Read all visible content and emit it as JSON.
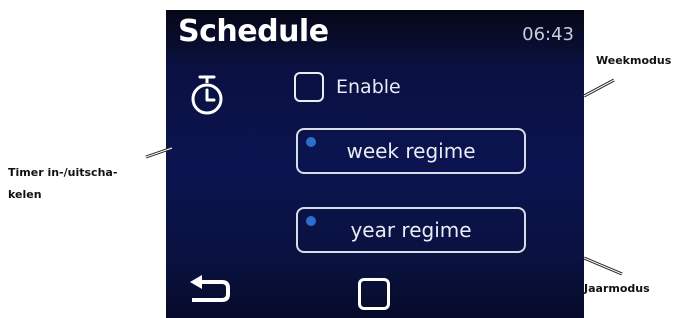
{
  "screen": {
    "title": "Schedule",
    "clock": "06:43",
    "enable_label": "Enable",
    "week_button_label": "week regime",
    "year_button_label": "year regime",
    "enable_checked": false
  },
  "annotations": {
    "timer": "Timer in-/uitscha-kelen",
    "week": "Weekmodus",
    "jaar": "Jaarmodus"
  },
  "colors": {
    "screen_bg": "#0b1450",
    "accent_dot": "#2a6fd0",
    "text": "#e8ecf4"
  },
  "icons": {
    "timer": "stopwatch-icon",
    "back": "back-arrow-icon",
    "home": "home-square-icon"
  }
}
